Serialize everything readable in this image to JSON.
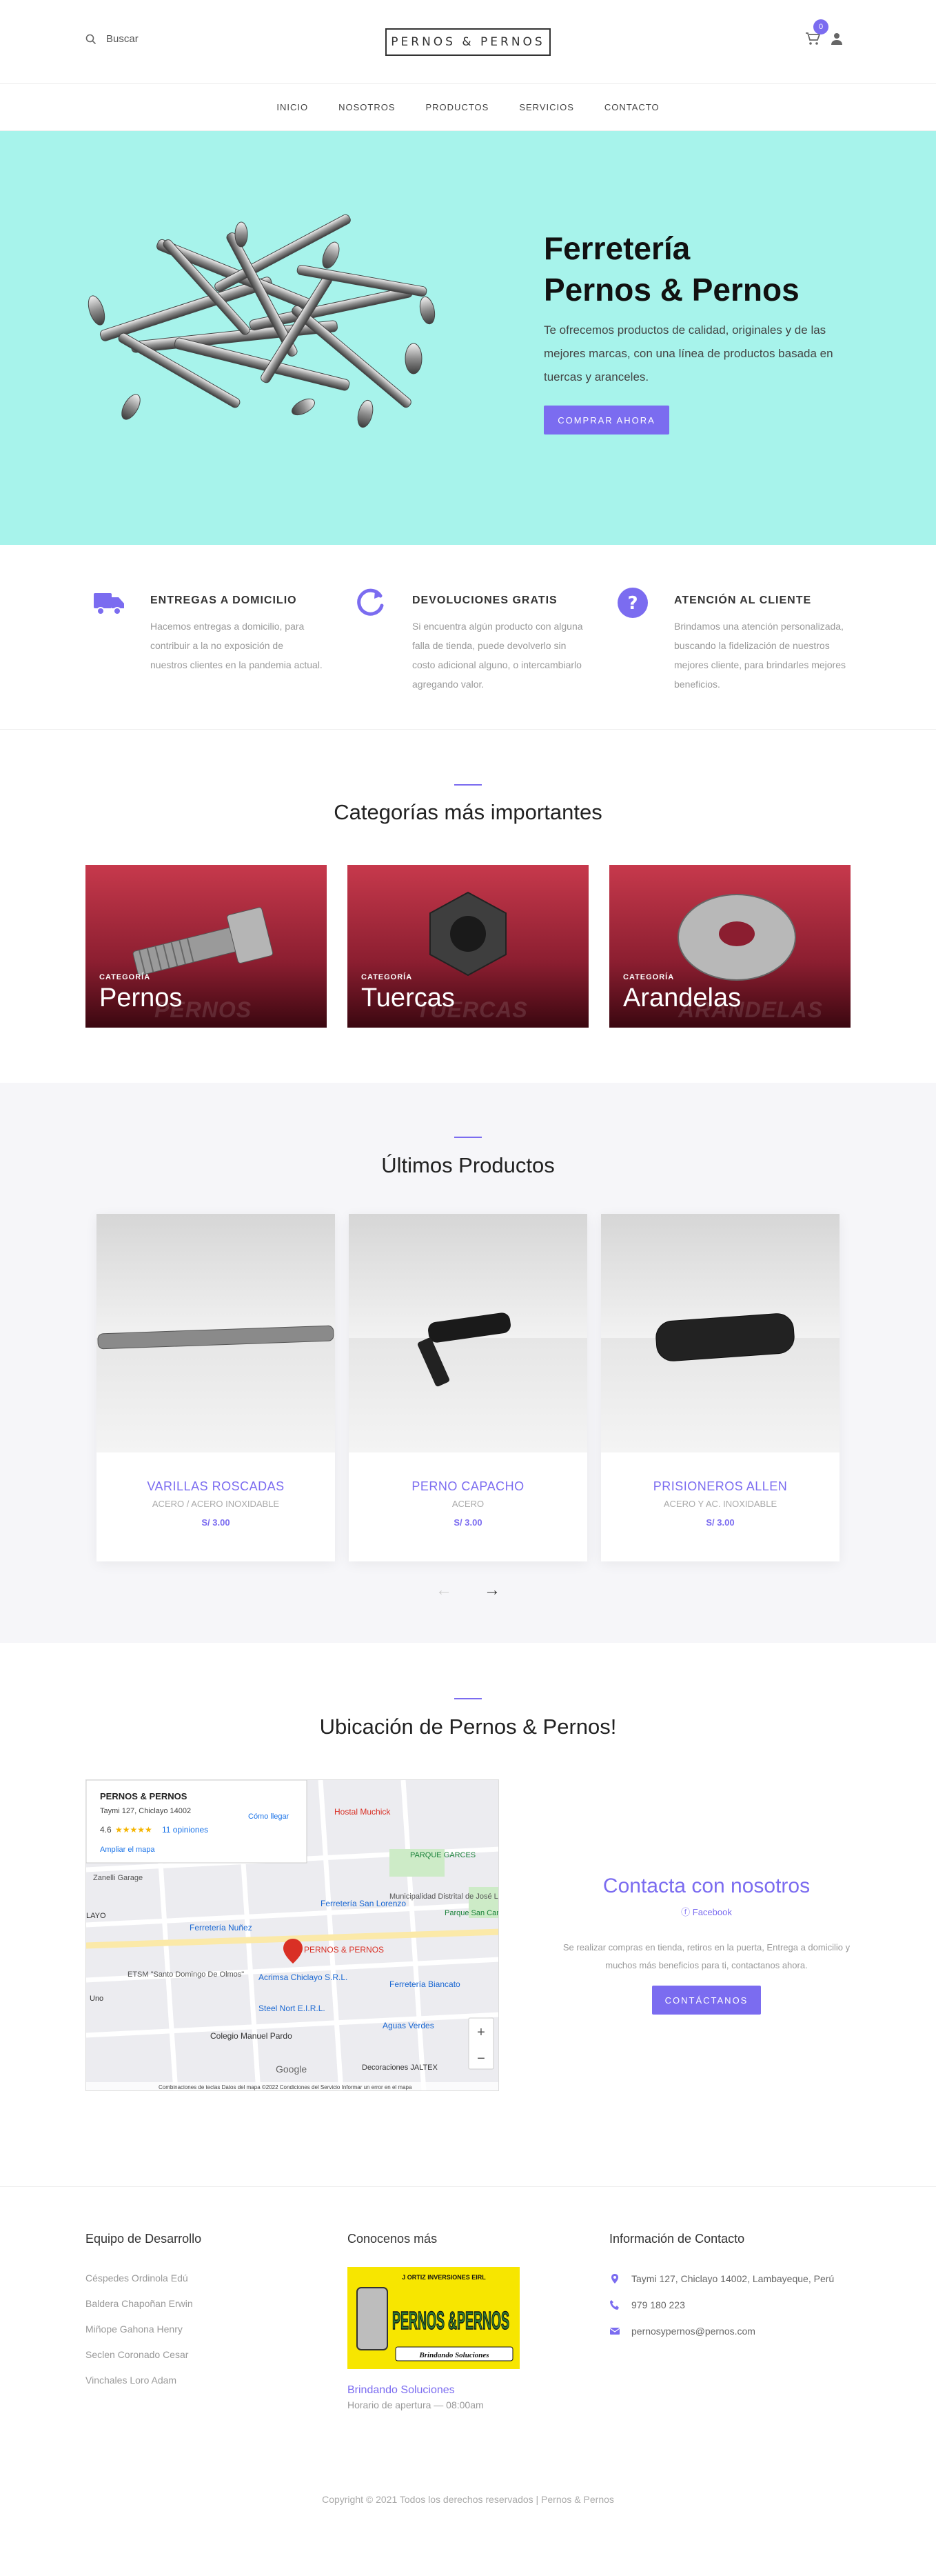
{
  "header": {
    "search_placeholder": "Buscar",
    "logo_text": "PERNOS & PERNOS",
    "cart_count": "0"
  },
  "nav": {
    "items": [
      "INICIO",
      "NOSOTROS",
      "PRODUCTOS",
      "SERVICIOS",
      "CONTACTO"
    ]
  },
  "hero": {
    "title_line1": "Ferretería",
    "title_line2": "Pernos & Pernos",
    "description": "Te ofrecemos productos de calidad, originales y de las mejores marcas, con una línea de productos basada en tuercas y aranceles.",
    "button": "COMPRAR AHORA"
  },
  "features": [
    {
      "icon": "truck-icon",
      "title": "ENTREGAS A DOMICILIO",
      "text": "Hacemos entregas a domicilio, para contribuir a la no exposición de nuestros clientes en la pandemia actual."
    },
    {
      "icon": "refresh-icon",
      "title": "DEVOLUCIONES GRATIS",
      "text": "Si encuentra algún producto con alguna falla de tienda, puede devolverlo sin costo adicional alguno, o intercambiarlo agregando valor."
    },
    {
      "icon": "question-icon",
      "title": "ATENCIÓN AL CLIENTE",
      "text": "Brindamos una atención personalizada, buscando la fidelización de nuestros mejores cliente, para brindarles mejores beneficios."
    }
  ],
  "categories": {
    "title": "Categorías más importantes",
    "label": "CATEGORÍA",
    "items": [
      {
        "name": "Pernos",
        "ghost": "PERNOS"
      },
      {
        "name": "Tuercas",
        "ghost": "TUERCAS"
      },
      {
        "name": "Arandelas",
        "ghost": "ARANDELAS"
      }
    ]
  },
  "products": {
    "title": "Últimos Productos",
    "items": [
      {
        "name": "VARILLAS ROSCADAS",
        "material": "ACERO / ACERO INOXIDABLE",
        "price": "S/ 3.00"
      },
      {
        "name": "PERNO CAPACHO",
        "material": "ACERO",
        "price": "S/ 3.00"
      },
      {
        "name": "PRISIONEROS ALLEN",
        "material": "ACERO Y AC. INOXIDABLE",
        "price": "S/ 3.00"
      }
    ]
  },
  "location": {
    "title": "Ubicación de Pernos & Pernos!",
    "map": {
      "place_name": "PERNOS & PERNOS",
      "address": "Taymi 127, Chiclayo 14002",
      "rating": "4.6",
      "stars": "★★★★★",
      "reviews": "11 opiniones",
      "directions": "Cómo llegar",
      "larger_map": "Ampliar el mapa",
      "pin_label": "PERNOS & PERNOS",
      "labels": [
        "Hostal Muchick",
        "PARQUE GARCES",
        "Municipalidad Distrital de José Leonardo",
        "Zanelli Garage",
        "Ferretería San Lorenzo",
        "Ferretería Nuñez",
        "Parque San Carlos",
        "Acrimsa Chiclayo S.R.L.",
        "ETSM \"Santo Domingo De Olmos\"",
        "Steel Nort E.I.R.L.",
        "Ferretería Biancato",
        "Colegio Manuel Pardo",
        "Aguas Verdes",
        "Decoraciones JALTEX",
        "LAYO",
        "Uno",
        "Google"
      ],
      "footer": "Combinaciones de teclas   Datos del mapa ©2022   Condiciones del Servicio   Informar un error en el mapa"
    }
  },
  "contact": {
    "title": "Contacta con nosotros",
    "facebook": "Facebook",
    "text": "Se realizar compras en tienda, retiros en la puerta, Entrega a domicilio y muchos más beneficios para ti, contactanos ahora.",
    "button": "CONTÁCTANOS"
  },
  "footer": {
    "team_title": "Equipo de Desarrollo",
    "team": [
      "Céspedes Ordinola Edú",
      "Baldera Chapoñan Erwin",
      "Miñope Gahona Henry",
      "Seclen Coronado Cesar",
      "Vinchales Loro Adam"
    ],
    "know_title": "Conocenos más",
    "brand_top": "J ORTIZ INVERSIONES EIRL",
    "brand_main": "PERNOS &PERNOS",
    "brand_tag": "Brindando Soluciones",
    "know_link": "Brindando Soluciones",
    "hours": "Horario de apertura — 08:00am",
    "info_title": "Información de Contacto",
    "address": "Taymi 127, Chiclayo 14002, Lambayeque, Perú",
    "phone": "979 180 223",
    "email": "pernosypernos@pernos.com"
  },
  "copyright": "Copyright © 2021 Todos los derechos reservados | Pernos & Pernos",
  "colors": {
    "accent": "#7b6cf0",
    "hero_bg": "#a7f3eb"
  }
}
